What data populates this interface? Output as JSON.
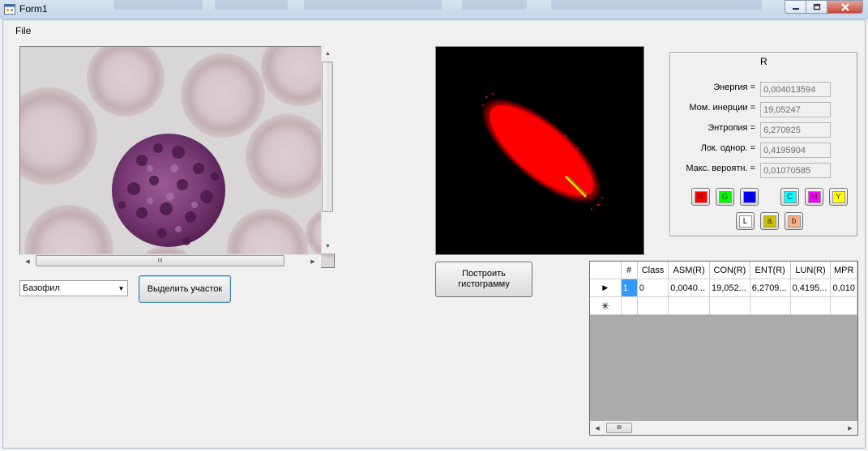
{
  "window": {
    "title": "Form1"
  },
  "menu": {
    "file_label": "File"
  },
  "image_panel": {
    "scroll_grip": "III"
  },
  "controls": {
    "class_selected": "Базофил",
    "select_button_label": "Выделить участок",
    "histogram_button_label": "Построить гистограмму"
  },
  "features": {
    "title": "R",
    "items": [
      {
        "label": "Энергия =",
        "value": "0,004013594"
      },
      {
        "label": "Мом. инерции =",
        "value": "19,05247"
      },
      {
        "label": "Энтропия =",
        "value": "6,270925"
      },
      {
        "label": "Лок. однор. =",
        "value": "0,4195904"
      },
      {
        "label": "Макс. вероятн. =",
        "value": "0,01070585"
      }
    ],
    "color_buttons": [
      {
        "name": "R",
        "label": "R",
        "color": "#ff0000"
      },
      {
        "name": "G",
        "label": "G",
        "color": "#00ff00"
      },
      {
        "name": "B",
        "label": "B",
        "color": "#0000ff"
      },
      {
        "name": "C",
        "label": "C",
        "color": "#00ffff"
      },
      {
        "name": "M",
        "label": "M",
        "color": "#ff00ff"
      },
      {
        "name": "Y",
        "label": "Y",
        "color": "#ffff00"
      },
      {
        "name": "L",
        "label": "L",
        "color": "#ffffff"
      },
      {
        "name": "a",
        "label": "a",
        "color": "#c8c000"
      },
      {
        "name": "b",
        "label": "b",
        "color": "#f4b183"
      }
    ]
  },
  "grid": {
    "columns": [
      "#",
      "Class",
      "ASM(R)",
      "CON(R)",
      "ENT(R)",
      "LUN(R)",
      "MPR"
    ],
    "rows": [
      [
        "1",
        "0",
        "0,0040...",
        "19,052...",
        "6,2709...",
        "0,4195...",
        "0,010"
      ]
    ],
    "scroll_grip": "III"
  }
}
